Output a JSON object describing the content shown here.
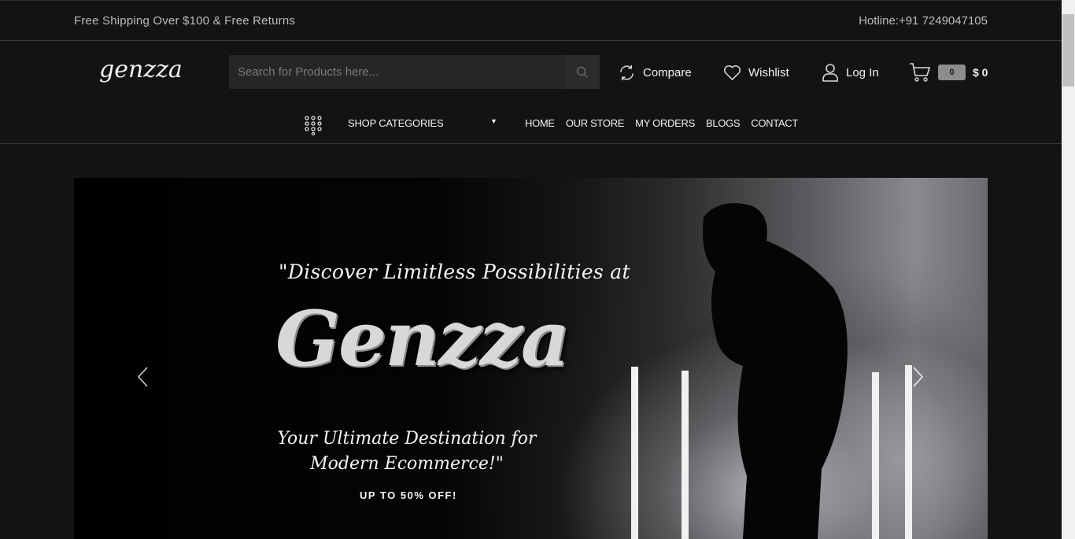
{
  "topbar": {
    "promo": "Free Shipping Over $100 & Free Returns",
    "hotline": "Hotline:+91 7249047105"
  },
  "header": {
    "logo": "genzza",
    "search": {
      "placeholder": "Search for Products here...",
      "icon": "search-icon"
    },
    "actions": {
      "compare": {
        "label": "Compare",
        "icon": "refresh-icon"
      },
      "wishlist": {
        "label": "Wishlist",
        "icon": "heart-icon"
      },
      "login": {
        "label": "Log In",
        "icon": "user-icon"
      },
      "cart": {
        "count": "0",
        "total": "$ 0",
        "icon": "cart-icon"
      }
    }
  },
  "nav": {
    "shop_categories": "SHOP CATEGORIES",
    "items": [
      "HOME",
      "OUR STORE",
      "MY ORDERS",
      "BLOGS",
      "CONTACT"
    ]
  },
  "hero": {
    "tagline_top": "\"Discover Limitless Possibilities at",
    "brand": "Genzza",
    "tagline_bottom": "Your Ultimate Destination for Modern Ecommerce!\"",
    "offer": "UP TO 50% OFF!"
  },
  "colors": {
    "background": "#131313",
    "search_bg": "#262626",
    "cart_badge": "#8d8d8d"
  }
}
